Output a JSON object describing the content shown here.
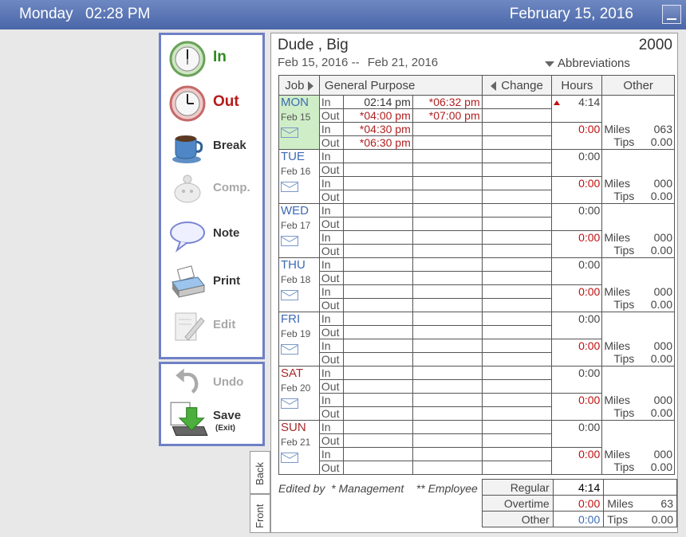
{
  "topbar": {
    "day": "Monday",
    "time": "02:28 PM",
    "date": "February 15, 2016"
  },
  "tools": [
    {
      "label": "In",
      "color": "#2e8b1f",
      "icon": "clock-in-icon"
    },
    {
      "label": "Out",
      "color": "#b51c1c",
      "icon": "clock-out-icon"
    },
    {
      "label": "Break",
      "color": "#333333",
      "icon": "coffee-cup-icon"
    },
    {
      "label": "Comp.",
      "color": "#a8a8a8",
      "icon": "piggy-bank-icon"
    },
    {
      "label": "Note",
      "color": "#333333",
      "icon": "speech-bubble-icon"
    },
    {
      "label": "Print",
      "color": "#333333",
      "icon": "printer-icon"
    },
    {
      "label": "Edit",
      "color": "#a8a8a8",
      "icon": "edit-pencil-icon"
    }
  ],
  "actions": {
    "undo": "Undo",
    "save": "Save",
    "save_sub": "(Exit)"
  },
  "sheet": {
    "name": "Dude , Big",
    "id": "2000",
    "range_start": "Feb 15, 2016 --",
    "range_end": "Feb 21, 2016",
    "abbreviations": "Abbreviations",
    "headers": {
      "job": "Job",
      "purpose": "General Purpose",
      "change": "Change",
      "hours": "Hours",
      "other": "Other"
    },
    "io": [
      "In",
      "Out",
      "In",
      "Out"
    ],
    "days": [
      {
        "name": "MON",
        "date": "Feb 15",
        "hours1": "4:14",
        "hours2": "0:00",
        "miles": "063",
        "tips": "0.00",
        "times": [
          [
            "02:14 pm",
            "*06:32 pm"
          ],
          [
            "*04:00 pm",
            "*07:00 pm"
          ],
          [
            "*04:30 pm",
            ""
          ],
          [
            "*06:30 pm",
            ""
          ]
        ]
      },
      {
        "name": "TUE",
        "date": "Feb 16",
        "hours1": "0:00",
        "hours2": "0:00",
        "miles": "000",
        "tips": "0.00"
      },
      {
        "name": "WED",
        "date": "Feb 17",
        "hours1": "0:00",
        "hours2": "0:00",
        "miles": "000",
        "tips": "0.00"
      },
      {
        "name": "THU",
        "date": "Feb 18",
        "hours1": "0:00",
        "hours2": "0:00",
        "miles": "000",
        "tips": "0.00"
      },
      {
        "name": "FRI",
        "date": "Feb 19",
        "hours1": "0:00",
        "hours2": "0:00",
        "miles": "000",
        "tips": "0.00"
      },
      {
        "name": "SAT",
        "date": "Feb 20",
        "hours1": "0:00",
        "hours2": "0:00",
        "miles": "000",
        "tips": "0.00"
      },
      {
        "name": "SUN",
        "date": "Feb 21",
        "hours1": "0:00",
        "hours2": "0:00",
        "miles": "000",
        "tips": "0.00"
      }
    ],
    "miles_label": "Miles",
    "tips_label": "Tips",
    "edited_by": "Edited by",
    "legend_mgmt": "* Management",
    "legend_emp": "** Employee",
    "totals": {
      "regular_label": "Regular",
      "regular": "4:14",
      "overtime_label": "Overtime",
      "overtime": "0:00",
      "miles": "63",
      "other_label": "Other",
      "other": "0:00",
      "tips": "0.00"
    },
    "tabs": {
      "back": "Back",
      "front": "Front"
    }
  }
}
